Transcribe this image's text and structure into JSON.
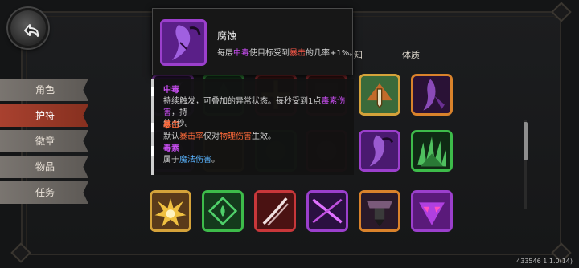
{
  "nav": {
    "items": [
      {
        "label": "角色",
        "active": false
      },
      {
        "label": "护符",
        "active": true
      },
      {
        "label": "徽章",
        "active": false
      },
      {
        "label": "物品",
        "active": false
      },
      {
        "label": "任务",
        "active": false
      }
    ]
  },
  "columns": {
    "col_known": "知",
    "col_body": "体质"
  },
  "tooltip": {
    "title": "腐蚀",
    "desc_prefix": "每层",
    "desc_poison": "中毒",
    "desc_mid": "使目标受到",
    "desc_crit": "暴击",
    "desc_suffix": "的几率+1%。"
  },
  "details": {
    "poison": {
      "head": "中毒",
      "line1": "持续触发，可叠加的异常状态。每秒受到1点",
      "line1_hl": "毒素伤害",
      "line1_end": "，持",
      "line2": "续4秒。"
    },
    "crit": {
      "head": "暴击",
      "pre": "默认",
      "hl1": "暴击率",
      "mid": "仅对",
      "hl2": "物理伤害",
      "post": "生效。"
    },
    "toxin": {
      "head": "毒素",
      "pre": "属于",
      "hl": "魔法伤害",
      "post": "。"
    }
  },
  "version": "433546 1.1.0(14)",
  "icons": {
    "back": "back-arrow-icon",
    "charm": "charm-icon"
  },
  "colors": {
    "gold": "#d4a23a",
    "green": "#3dbb4a",
    "red": "#c8373a",
    "purple": "#9b3fcc",
    "orange": "#d9822b",
    "active_tab": "#a9412f"
  }
}
